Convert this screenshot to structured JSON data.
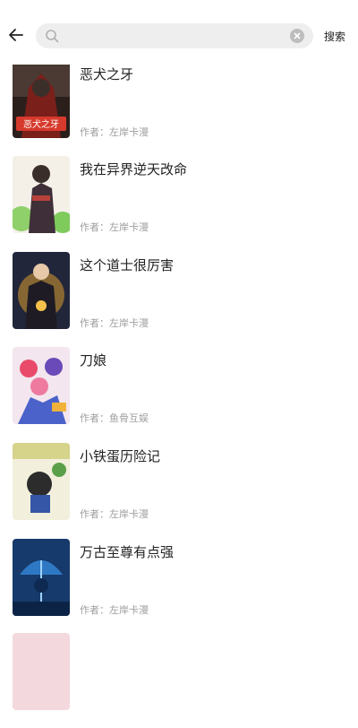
{
  "header": {
    "search_placeholder": "",
    "search_value": "",
    "search_button_label": "搜索"
  },
  "results": [
    {
      "title": "恶犬之牙",
      "author_prefix": "作者：",
      "author": "左岸卡漫"
    },
    {
      "title": "我在异界逆天改命",
      "author_prefix": "作者：",
      "author": "左岸卡漫"
    },
    {
      "title": "这个道士很厉害",
      "author_prefix": "作者：",
      "author": "左岸卡漫"
    },
    {
      "title": "刀娘",
      "author_prefix": "作者：",
      "author": "鱼骨互娱"
    },
    {
      "title": "小铁蛋历险记",
      "author_prefix": "作者：",
      "author": "左岸卡漫"
    },
    {
      "title": "万古至尊有点强",
      "author_prefix": "作者：",
      "author": "左岸卡漫"
    }
  ],
  "cover_text": {
    "cover_1": "恶犬之牙"
  },
  "colors": {
    "search_bg": "#eeeeee",
    "text_primary": "#222222",
    "text_secondary": "#9e9e9e"
  }
}
